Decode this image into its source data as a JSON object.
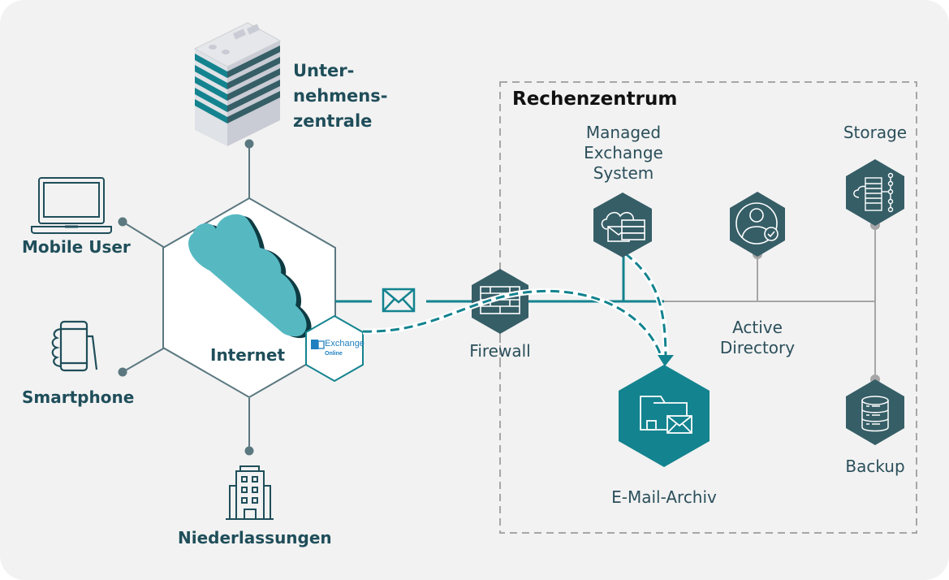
{
  "diagram": {
    "title": "Rechenzentrum",
    "left_nodes": {
      "headquarters": {
        "label_lines": [
          "Unter-",
          "nehmens-",
          "zentrale"
        ],
        "icon": "office-tower-icon"
      },
      "mobile_user": {
        "label": "Mobile User",
        "icon": "laptop-icon"
      },
      "smartphone": {
        "label": "Smartphone",
        "icon": "smartphone-hand-icon"
      },
      "branches": {
        "label": "Niederlassungen",
        "icon": "building-icon"
      },
      "internet": {
        "label": "Internet",
        "icon": "cloud-icon"
      },
      "exchange_online": {
        "brand": "Exchange",
        "sub": "Online",
        "icon": "exchange-logo-icon"
      }
    },
    "connector": {
      "icon": "envelope-icon"
    },
    "firewall": {
      "label": "Firewall",
      "icon": "brick-wall-icon"
    },
    "datacenter_nodes": {
      "managed_exchange": {
        "label_lines": [
          "Managed",
          "Exchange",
          "System"
        ],
        "icon": "cloud-mail-server-icon"
      },
      "active_directory": {
        "label_lines": [
          "Active",
          "Directory"
        ],
        "icon": "user-check-icon"
      },
      "storage": {
        "label": "Storage",
        "icon": "storage-network-icon"
      },
      "email_archive": {
        "label": "E-Mail-Archiv",
        "icon": "folder-mail-icon"
      },
      "backup": {
        "label": "Backup",
        "icon": "database-icon"
      }
    },
    "colors": {
      "background": "#f2f2f2",
      "dark_teal": "#365e67",
      "teal": "#13838f",
      "cloud": "#56b9c2",
      "line_gray": "#a6a6a6",
      "hex_outline": "#5b7880",
      "label_dark": "#1f4e5a"
    }
  }
}
